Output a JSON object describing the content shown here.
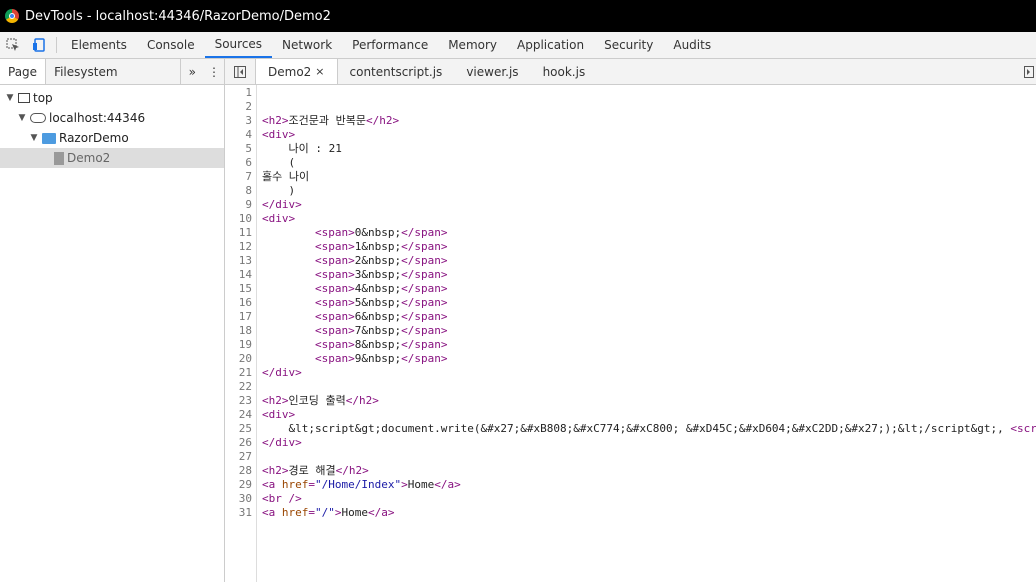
{
  "window": {
    "title": "DevTools - localhost:44346/RazorDemo/Demo2"
  },
  "toolbar": {
    "icons": [
      "inspect-icon",
      "device-toolbar-icon"
    ],
    "tabs": [
      "Elements",
      "Console",
      "Sources",
      "Network",
      "Performance",
      "Memory",
      "Application",
      "Security",
      "Audits"
    ],
    "active_tab": "Sources"
  },
  "navigator": {
    "tabs": [
      "Page",
      "Filesystem"
    ],
    "more": "»",
    "menu": "⋮",
    "tree": [
      {
        "label": "top",
        "icon": "frame-icon",
        "depth": 0
      },
      {
        "label": "localhost:44346",
        "icon": "cloud-icon",
        "depth": 1
      },
      {
        "label": "RazorDemo",
        "icon": "folder-icon",
        "depth": 2
      },
      {
        "label": "Demo2",
        "icon": "file-icon",
        "depth": 3
      }
    ]
  },
  "editor_tabs": {
    "tabs": [
      "Demo2",
      "contentscript.js",
      "viewer.js",
      "hook.js"
    ],
    "close": "×"
  },
  "code": {
    "line_numbers": [
      "1",
      "2",
      "3",
      "4",
      "5",
      "6",
      "7",
      "8",
      "9",
      "10",
      "11",
      "12",
      "13",
      "14",
      "15",
      "16",
      "17",
      "18",
      "19",
      "20",
      "21",
      "22",
      "23",
      "24",
      "25",
      "26",
      "27",
      "28",
      "29",
      "30",
      "31"
    ],
    "lines": [
      [],
      [],
      [
        [
          "t",
          "<h2>"
        ],
        [
          "x",
          "조건문과 반복문"
        ],
        [
          "t",
          "</h2>"
        ]
      ],
      [
        [
          "t",
          "<div>"
        ]
      ],
      [
        [
          "x",
          "    나이 : 21"
        ]
      ],
      [
        [
          "x",
          "    ("
        ]
      ],
      [
        [
          "x",
          "홀수 나이"
        ]
      ],
      [
        [
          "x",
          "    )"
        ]
      ],
      [
        [
          "t",
          "</div>"
        ]
      ],
      [
        [
          "t",
          "<div>"
        ]
      ],
      [
        [
          "x",
          "        "
        ],
        [
          "t",
          "<span>"
        ],
        [
          "x",
          "0&nbsp;"
        ],
        [
          "t",
          "</span>"
        ]
      ],
      [
        [
          "x",
          "        "
        ],
        [
          "t",
          "<span>"
        ],
        [
          "x",
          "1&nbsp;"
        ],
        [
          "t",
          "</span>"
        ]
      ],
      [
        [
          "x",
          "        "
        ],
        [
          "t",
          "<span>"
        ],
        [
          "x",
          "2&nbsp;"
        ],
        [
          "t",
          "</span>"
        ]
      ],
      [
        [
          "x",
          "        "
        ],
        [
          "t",
          "<span>"
        ],
        [
          "x",
          "3&nbsp;"
        ],
        [
          "t",
          "</span>"
        ]
      ],
      [
        [
          "x",
          "        "
        ],
        [
          "t",
          "<span>"
        ],
        [
          "x",
          "4&nbsp;"
        ],
        [
          "t",
          "</span>"
        ]
      ],
      [
        [
          "x",
          "        "
        ],
        [
          "t",
          "<span>"
        ],
        [
          "x",
          "5&nbsp;"
        ],
        [
          "t",
          "</span>"
        ]
      ],
      [
        [
          "x",
          "        "
        ],
        [
          "t",
          "<span>"
        ],
        [
          "x",
          "6&nbsp;"
        ],
        [
          "t",
          "</span>"
        ]
      ],
      [
        [
          "x",
          "        "
        ],
        [
          "t",
          "<span>"
        ],
        [
          "x",
          "7&nbsp;"
        ],
        [
          "t",
          "</span>"
        ]
      ],
      [
        [
          "x",
          "        "
        ],
        [
          "t",
          "<span>"
        ],
        [
          "x",
          "8&nbsp;"
        ],
        [
          "t",
          "</span>"
        ]
      ],
      [
        [
          "x",
          "        "
        ],
        [
          "t",
          "<span>"
        ],
        [
          "x",
          "9&nbsp;"
        ],
        [
          "t",
          "</span>"
        ]
      ],
      [
        [
          "t",
          "</div>"
        ]
      ],
      [],
      [
        [
          "t",
          "<h2>"
        ],
        [
          "x",
          "인코딩 출력"
        ],
        [
          "t",
          "</h2>"
        ]
      ],
      [
        [
          "t",
          "<div>"
        ]
      ],
      [
        [
          "x",
          "    &lt;script&gt;document.write(&#x27;&#xB808;&#xC774;&#xC800; &#xD45C;&#xD604;&#xC2DD;&#x27;);&lt;/script&gt;, "
        ],
        [
          "t",
          "<scri"
        ]
      ],
      [
        [
          "t",
          "</div>"
        ]
      ],
      [],
      [
        [
          "t",
          "<h2>"
        ],
        [
          "x",
          "경로 해결"
        ],
        [
          "t",
          "</h2>"
        ]
      ],
      [
        [
          "t",
          "<a "
        ],
        [
          "a",
          "href"
        ],
        [
          "t",
          "="
        ],
        [
          "v",
          "\"/Home/Index\""
        ],
        [
          "t",
          ">"
        ],
        [
          "x",
          "Home"
        ],
        [
          "t",
          "</a>"
        ]
      ],
      [
        [
          "t",
          "<br />"
        ]
      ],
      [
        [
          "t",
          "<a "
        ],
        [
          "a",
          "href"
        ],
        [
          "t",
          "="
        ],
        [
          "v",
          "\"/\""
        ],
        [
          "t",
          ">"
        ],
        [
          "x",
          "Home"
        ],
        [
          "t",
          "</a>"
        ]
      ]
    ]
  }
}
